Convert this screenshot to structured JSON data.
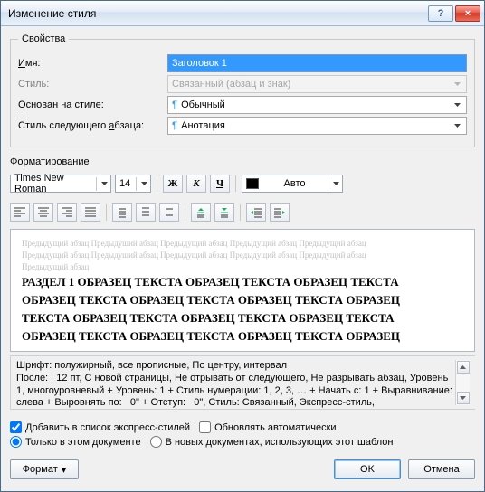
{
  "title": "Изменение стиля",
  "help_icon": "?",
  "close_icon": "×",
  "group_properties": "Свойства",
  "labels": {
    "name_pre": "",
    "name_u": "И",
    "name_post": "мя:",
    "style": "Стиль:",
    "based_pre": "",
    "based_u": "О",
    "based_post": "снован на стиле:",
    "next_pre": "Стиль следующего ",
    "next_u": "а",
    "next_post": "бзаца:"
  },
  "values": {
    "name": "Заголовок 1",
    "style": "Связанный (абзац и знак)",
    "based": "Обычный",
    "next": "Анотация"
  },
  "group_formatting": "Форматирование",
  "font": {
    "name": "Times New Roman",
    "size": "14",
    "color_label": "Авто"
  },
  "btns": {
    "bold": "Ж",
    "italic": "К",
    "underline": "Ч"
  },
  "ghost_lines": [
    "Предыдущий абзац Предыдущий абзац Предыдущий абзац Предыдущий абзац Предыдущий абзац",
    "Предыдущий абзац Предыдущий абзац Предыдущий абзац Предыдущий абзац Предыдущий абзац",
    "Предыдущий абзац"
  ],
  "sample_lines": [
    "РАЗДЕЛ 1 ОБРАЗЕЦ ТЕКСТА ОБРАЗЕЦ ТЕКСТА ОБРАЗЕЦ ТЕКСТА",
    "ОБРАЗЕЦ ТЕКСТА ОБРАЗЕЦ ТЕКСТА ОБРАЗЕЦ ТЕКСТА ОБРАЗЕЦ",
    "ТЕКСТА ОБРАЗЕЦ ТЕКСТА ОБРАЗЕЦ ТЕКСТА ОБРАЗЕЦ ТЕКСТА",
    "ОБРАЗЕЦ ТЕКСТА ОБРАЗЕЦ ТЕКСТА ОБРАЗЕЦ ТЕКСТА ОБРАЗЕЦ"
  ],
  "description": "Шрифт: полужирный, все прописные, По центру, интервал\nПосле:   12 пт, С новой страницы, Не отрывать от следующего, Не разрывать абзац, Уровень 1, многоуровневый + Уровень: 1 + Стиль нумерации: 1, 2, 3, … + Начать с: 1 + Выравнивание: слева + Выровнять по:   0\" + Отступ:   0\", Стиль: Связанный, Экспресс-стиль,",
  "options": {
    "add_express_pre": "Добавить в список ",
    "add_express_u": "э",
    "add_express_post": "кспресс-стилей",
    "auto_update": "Обновлять автоматически",
    "only_doc_pre": "",
    "only_doc_u": "Т",
    "only_doc_post": "олько в этом документе",
    "in_new": "В новых документах, использующих этот шаблон"
  },
  "footer": {
    "format_pre": "Ф",
    "format_u": "о",
    "format_post": "рмат",
    "ok": "OK",
    "cancel": "Отмена"
  }
}
